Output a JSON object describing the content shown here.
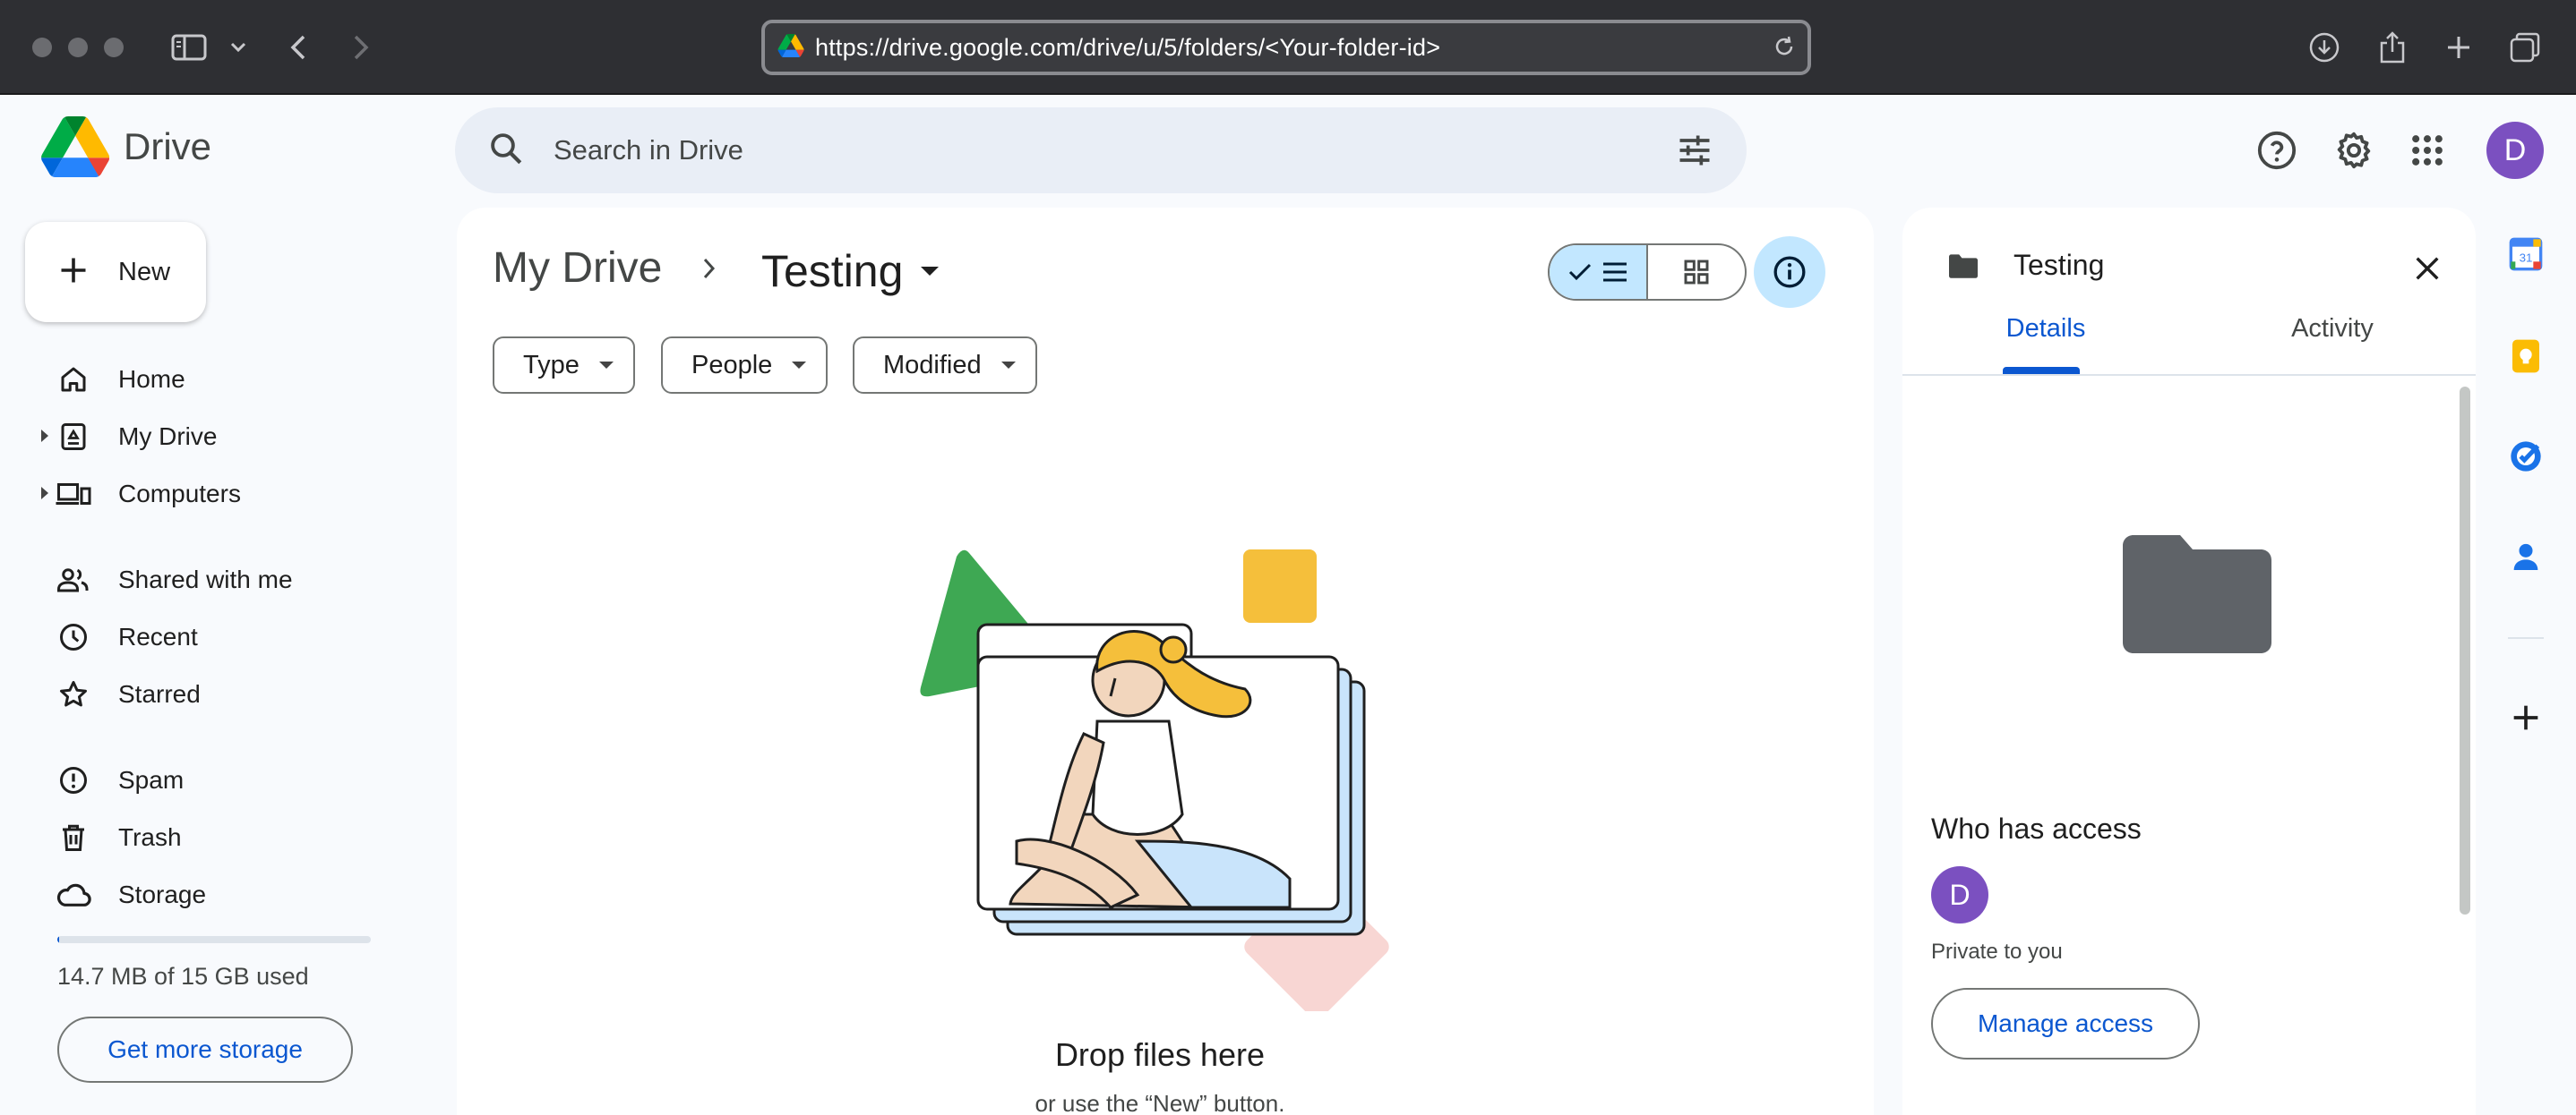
{
  "browser": {
    "url": "https://drive.google.com/drive/u/5/folders/<Your-folder-id>"
  },
  "app": {
    "name": "Drive",
    "search_placeholder": "Search in Drive",
    "avatar_initial": "D"
  },
  "sidebar": {
    "new_label": "New",
    "items": [
      {
        "label": "Home",
        "icon": "home-icon"
      },
      {
        "label": "My Drive",
        "icon": "my-drive-icon"
      },
      {
        "label": "Computers",
        "icon": "computers-icon"
      },
      {
        "label": "Shared with me",
        "icon": "shared-icon"
      },
      {
        "label": "Recent",
        "icon": "clock-icon"
      },
      {
        "label": "Starred",
        "icon": "star-icon"
      },
      {
        "label": "Spam",
        "icon": "spam-icon"
      },
      {
        "label": "Trash",
        "icon": "trash-icon"
      },
      {
        "label": "Storage",
        "icon": "cloud-icon"
      }
    ],
    "storage_text": "14.7 MB of 15 GB used",
    "storage_fraction": 0.001,
    "get_storage_label": "Get more storage"
  },
  "main": {
    "breadcrumb_root": "My Drive",
    "breadcrumb_current": "Testing",
    "filters": [
      "Type",
      "People",
      "Modified"
    ],
    "empty_title": "Drop files here",
    "empty_subtitle": "or use the “New” button."
  },
  "details": {
    "folder_name": "Testing",
    "tabs": [
      "Details",
      "Activity"
    ],
    "active_tab": "Details",
    "who_has_access": "Who has access",
    "owner_initial": "D",
    "private_text": "Private to you",
    "manage_access_label": "Manage access"
  },
  "colors": {
    "accent": "#0b57d0",
    "avatar": "#7b50c0",
    "selected_toggle": "#c2e7ff",
    "folder_gray": "#5f6368"
  }
}
